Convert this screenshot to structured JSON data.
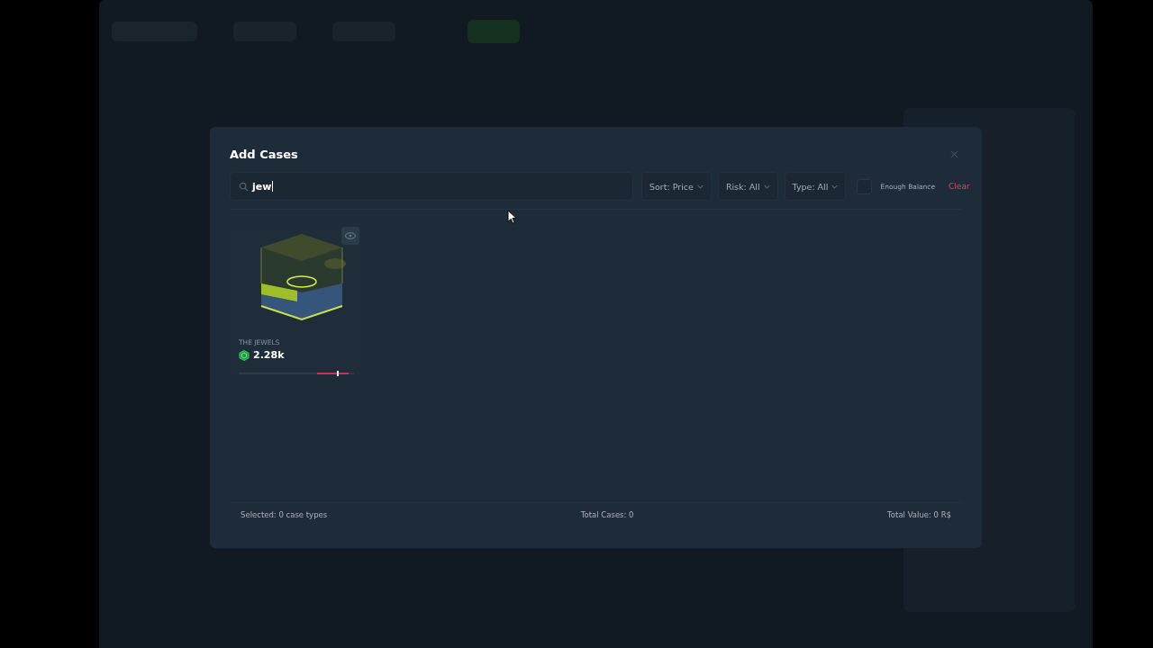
{
  "modal": {
    "title": "Add Cases",
    "search": {
      "value": "jew"
    },
    "filters": [
      {
        "label": "Sort: Price"
      },
      {
        "label": "Risk: All"
      },
      {
        "label": "Type: All"
      }
    ],
    "enough_balance": {
      "label": "Enough Balance",
      "checked": false
    },
    "clear": "Clear",
    "cases": [
      {
        "name": "THE JEWELS",
        "price": "2.28k",
        "risk_meter": {
          "level": 0.85
        }
      }
    ],
    "footer": {
      "selected": "Selected: 0 case types",
      "total_cases": "Total Cases: 0",
      "total_value": "Total Value: 0 R$"
    }
  }
}
